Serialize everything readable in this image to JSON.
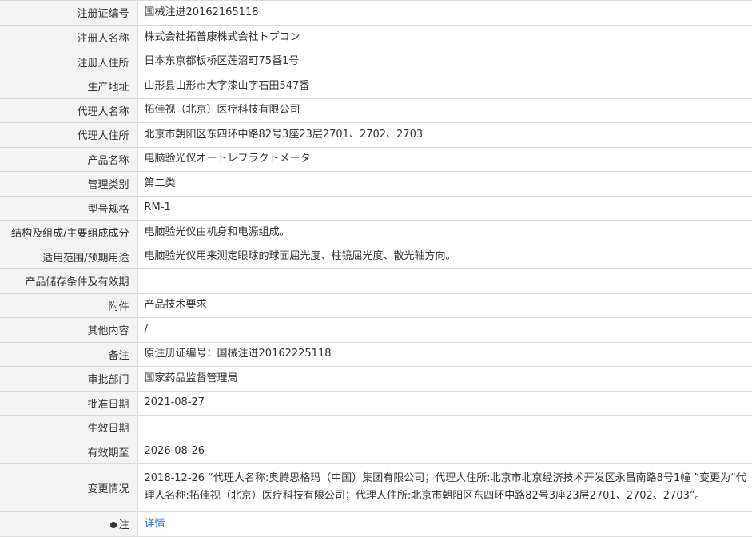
{
  "rows": [
    {
      "label": "注册证编号",
      "value": "国械注进20162165118"
    },
    {
      "label": "注册人名称",
      "value": "株式会社拓普康株式会社トプコン"
    },
    {
      "label": "注册人住所",
      "value": "日本东京都板桥区莲沼町75番1号"
    },
    {
      "label": "生产地址",
      "value": "山形县山形市大字漆山字石田547番"
    },
    {
      "label": "代理人名称",
      "value": "拓佳视（北京）医疗科技有限公司"
    },
    {
      "label": "代理人住所",
      "value": "北京市朝阳区东四环中路82号3座23层2701、2702、2703"
    },
    {
      "label": "产品名称",
      "value": "电脑验光仪オートレフラクトメータ"
    },
    {
      "label": "管理类别",
      "value": "第二类"
    },
    {
      "label": "型号规格",
      "value": "RM-1"
    },
    {
      "label": "结构及组成/主要组成成分",
      "value": "电脑验光仪由机身和电源组成。"
    },
    {
      "label": "适用范围/预期用途",
      "value": "电脑验光仪用来测定眼球的球面屈光度、柱镜屈光度、散光轴方向。"
    },
    {
      "label": "产品储存条件及有效期",
      "value": ""
    },
    {
      "label": "附件",
      "value": "产品技术要求"
    },
    {
      "label": "其他内容",
      "value": "/"
    },
    {
      "label": "备注",
      "value": "原注册证编号：国械注进20162225118"
    },
    {
      "label": "审批部门",
      "value": "国家药品监督管理局"
    },
    {
      "label": "批准日期",
      "value": "2021-08-27"
    },
    {
      "label": "生效日期",
      "value": ""
    },
    {
      "label": "有效期至",
      "value": "2026-08-26"
    },
    {
      "label": "变更情况",
      "value": "2018-12-26 “代理人名称:奥腾思格玛（中国）集团有限公司；代理人住所:北京市北京经济技术开发区永昌南路8号1幢 ”变更为“代理人名称:拓佳视（北京）医疗科技有限公司；代理人住所:北京市朝阳区东四环中路82号3座23层2701、2702、2703”。"
    }
  ],
  "note": {
    "label": "注",
    "link": "详情",
    "icon": "bulb-icon"
  },
  "colors": {
    "label_bg": "#f3f3f3",
    "border": "#dcdcdc",
    "link": "#2c76c4",
    "text": "#333333"
  }
}
